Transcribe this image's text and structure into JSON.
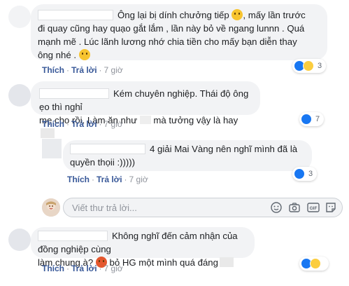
{
  "comments": [
    {
      "lines": [
        "Ông lại bị dính chưởng tiếp",
        ", mấy lần trước",
        "đi quay cũng hay quạo gắt lắm , lần này bỏ về ngang lunnn . Quá",
        "mạnh mẽ . Lúc lãnh lương nhớ chia tiền cho mấy bạn diễn thay",
        "ông nhé ."
      ],
      "like": "Thích",
      "reply": "Trả lời",
      "time": "7 giờ",
      "reaction_count": "3"
    },
    {
      "lines": [
        "Kém chuyên nghiệp. Thái độ ông ẹo thì nghỉ",
        "mẹ cho rồi. Làm ăn như",
        "mà tưởng vậy là hay"
      ],
      "like": "Thích",
      "reply": "Trả lời",
      "time": "7 giờ",
      "reaction_count": "7"
    },
    {
      "lines": [
        "4 giải Mai Vàng nên nghĩ mình đã là",
        "quyền thọii :)))))"
      ],
      "like": "Thích",
      "reply": "Trả lời",
      "time": "7 giờ",
      "reaction_count": "3"
    },
    {
      "lines": [
        "Không nghĩ đến cảm nhận của đồng nghiệp cùng",
        "làm chung à?",
        "bỏ HG một mình quá đáng"
      ],
      "like": "Thích",
      "reply": "Trả lời",
      "time": "7 giờ",
      "reaction_count": ""
    }
  ],
  "reply_box": {
    "placeholder": "Viết thư trả lời..."
  },
  "colors": {
    "link": "#385898",
    "like": "#1877f2",
    "bubble": "#f2f3f5"
  }
}
